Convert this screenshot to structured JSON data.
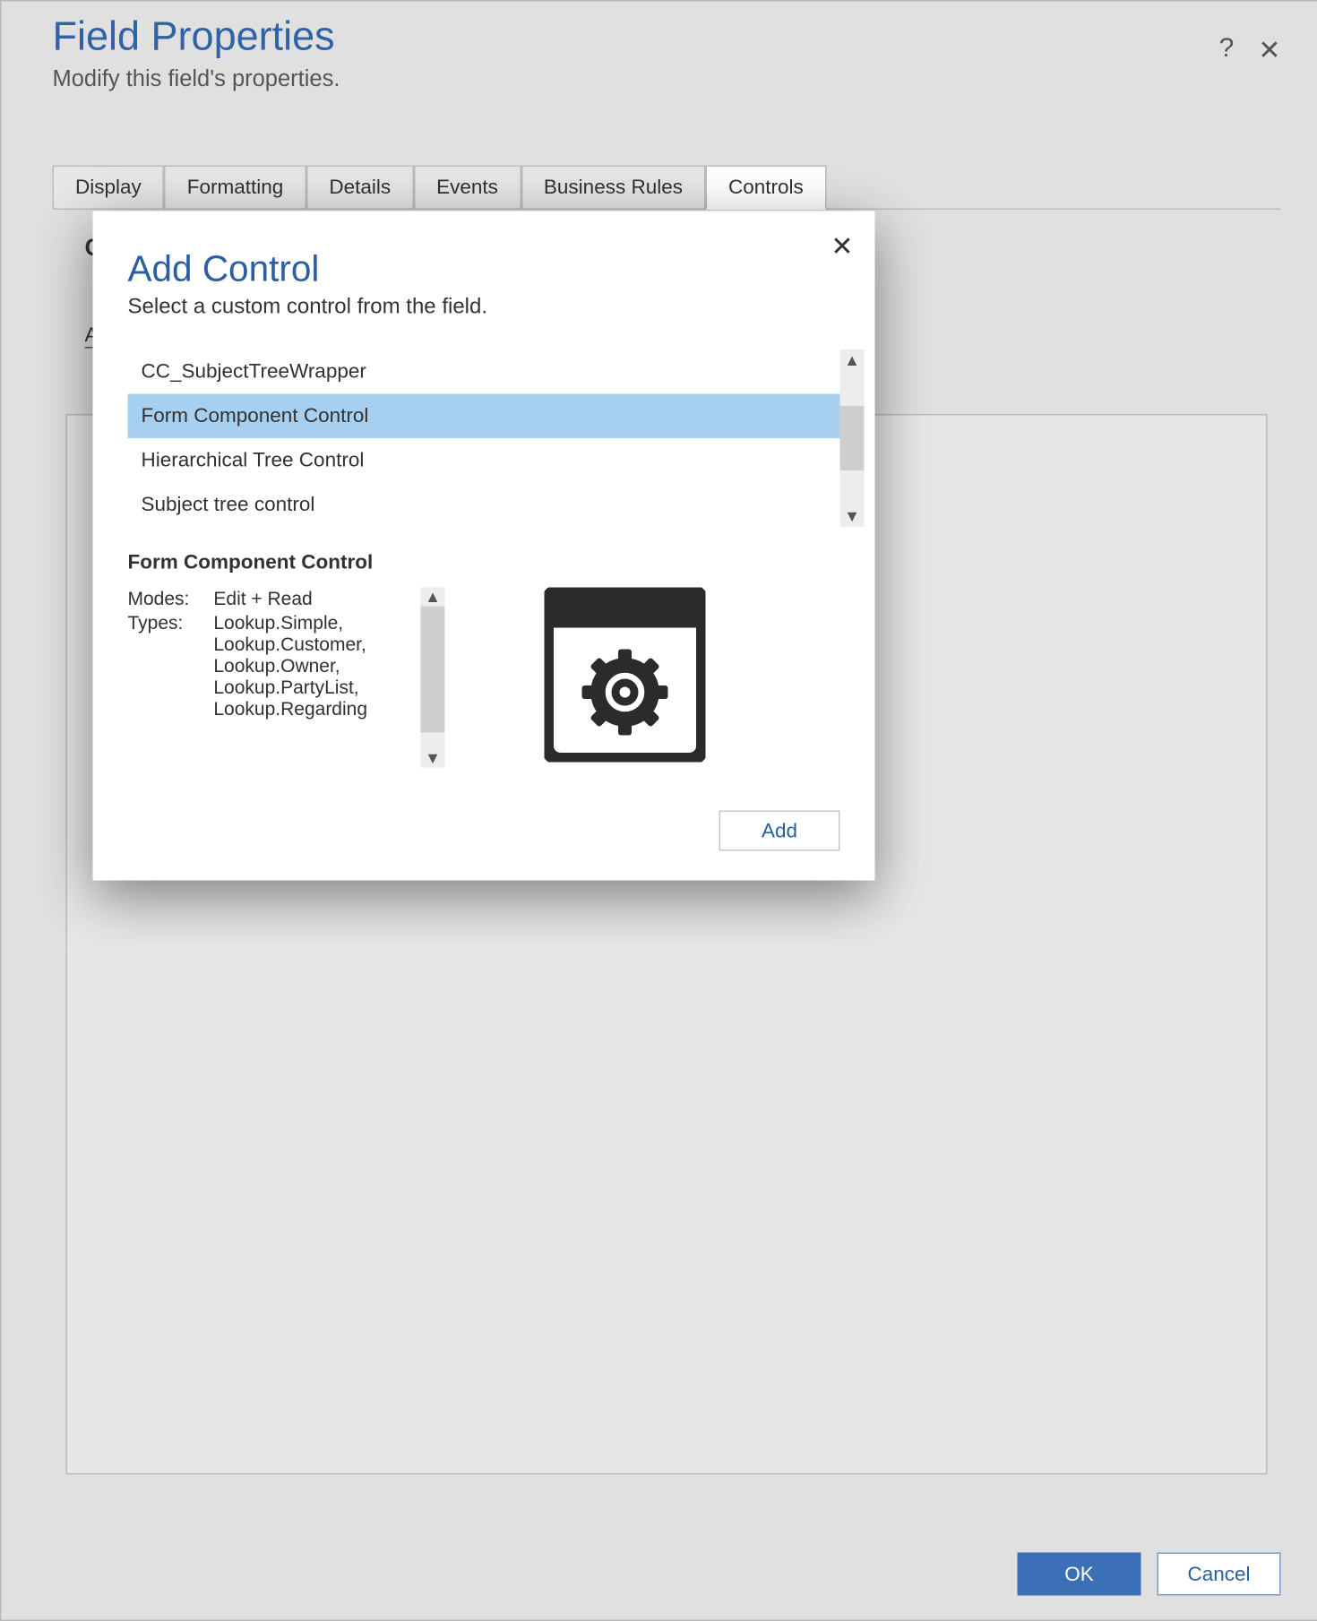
{
  "page": {
    "title": "Field Properties",
    "subtitle": "Modify this field's properties.",
    "help_tooltip": "?",
    "close_tooltip": "✕",
    "tabs": [
      "Display",
      "Formatting",
      "Details",
      "Events",
      "Business Rules",
      "Controls"
    ],
    "active_tab_index": 5,
    "footer": {
      "ok": "OK",
      "cancel": "Cancel"
    },
    "partial_link_first_char": "A",
    "partial_header_first_char": "C"
  },
  "modal": {
    "title": "Add Control",
    "subtitle": "Select a custom control from the field.",
    "list": [
      "CC_SubjectTreeWrapper",
      "Form Component Control",
      "Hierarchical Tree Control",
      "Subject tree control"
    ],
    "selected_index": 1,
    "detail": {
      "heading": "Form Component Control",
      "rows": {
        "modes_label": "Modes:",
        "modes_value": "Edit + Read",
        "types_label": "Types:",
        "types_lines": [
          "Lookup.Simple,",
          "Lookup.Customer,",
          "Lookup.Owner,",
          "Lookup.PartyList,",
          "Lookup.Regarding"
        ]
      }
    },
    "add_button": "Add"
  }
}
